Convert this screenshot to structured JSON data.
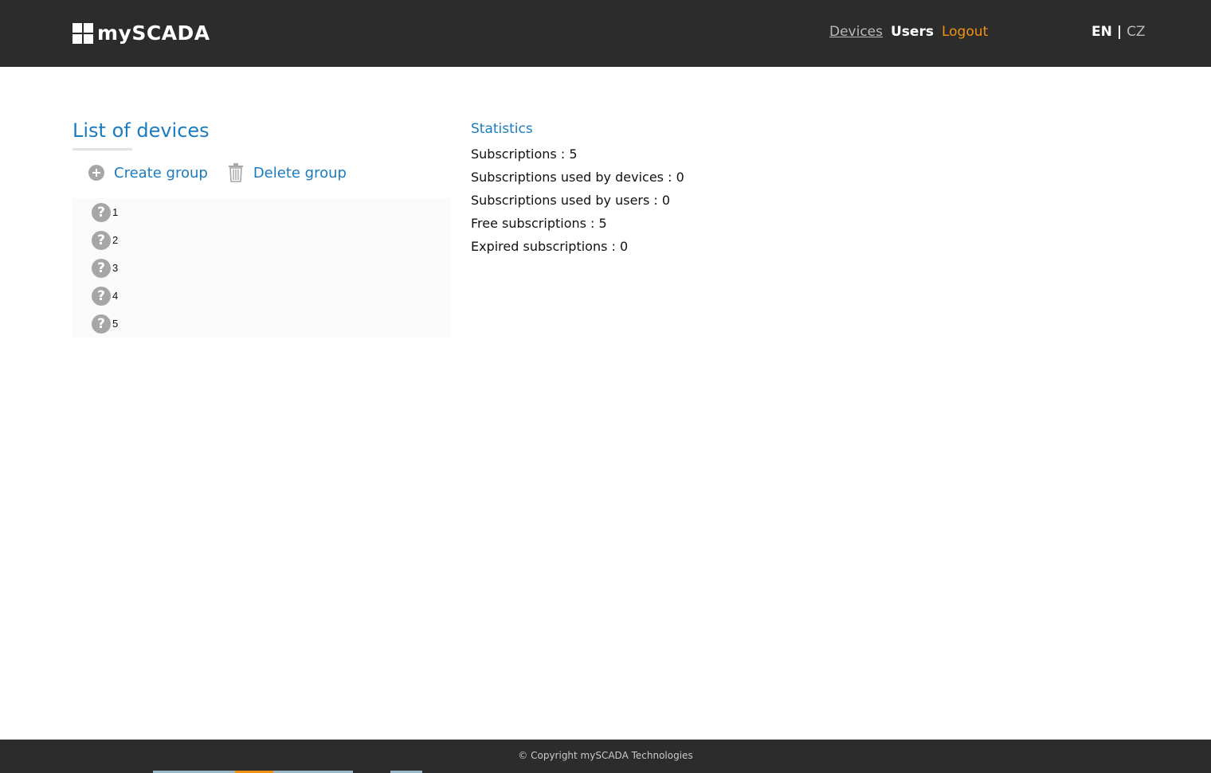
{
  "header": {
    "logo_text": "mySCADA",
    "nav": {
      "devices": "Devices",
      "users": "Users",
      "logout": "Logout"
    },
    "lang": {
      "en": "EN",
      "separator": "|",
      "cz": "CZ"
    }
  },
  "devices_panel": {
    "title": "List of devices",
    "actions": {
      "create_group": "Create group",
      "delete_group": "Delete group"
    },
    "items": [
      {
        "label": "1",
        "status_icon": "question-icon"
      },
      {
        "label": "2",
        "status_icon": "question-icon"
      },
      {
        "label": "3",
        "status_icon": "question-icon"
      },
      {
        "label": "4",
        "status_icon": "question-icon"
      },
      {
        "label": "5",
        "status_icon": "question-icon"
      }
    ]
  },
  "statistics": {
    "title": "Statistics",
    "lines": [
      "Subscriptions : 5",
      "Subscriptions used by devices : 0",
      "Subscriptions used by users : 0",
      "Free subscriptions : 5",
      "Expired subscriptions : 0"
    ]
  },
  "footer": {
    "copyright": "© Copyright mySCADA Technologies"
  },
  "colors": {
    "header_bg": "#2c2c2c",
    "accent_blue": "#1a7bbf",
    "logout_orange": "#f29214",
    "muted_grey": "#b9b9b9",
    "icon_grey": "#a6a6a6"
  }
}
